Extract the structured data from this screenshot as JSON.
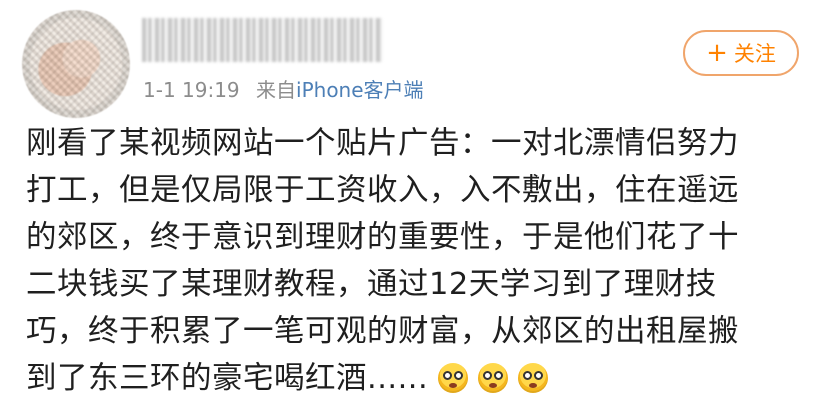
{
  "post": {
    "timestamp": "1-1 19:19",
    "source_prefix": "来自",
    "source_device": "iPhone客户端",
    "follow_label": "关注",
    "follow_icon": "plus-icon",
    "text_lines": [
      "刚看了某视频网站一个贴片广告：一对北漂情侣努力",
      "打工，但是仅局限于工资收入，入不敷出，住在遥远",
      "的郊区，终于意识到理财的重要性，于是他们花了十",
      "二块钱买了某理财教程，通过12天学习到了理财技",
      "巧，终于积累了一笔可观的财富，从郊区的出租屋搬",
      "到了东三环的豪宅喝红酒......"
    ],
    "emojis": [
      "dizzy-face-emoji",
      "dizzy-face-emoji",
      "dizzy-face-emoji"
    ]
  },
  "colors": {
    "follow": "#ff8200",
    "meta": "#8c8c8c",
    "device_link": "#4d7fb6",
    "text": "#1f1f1f"
  }
}
